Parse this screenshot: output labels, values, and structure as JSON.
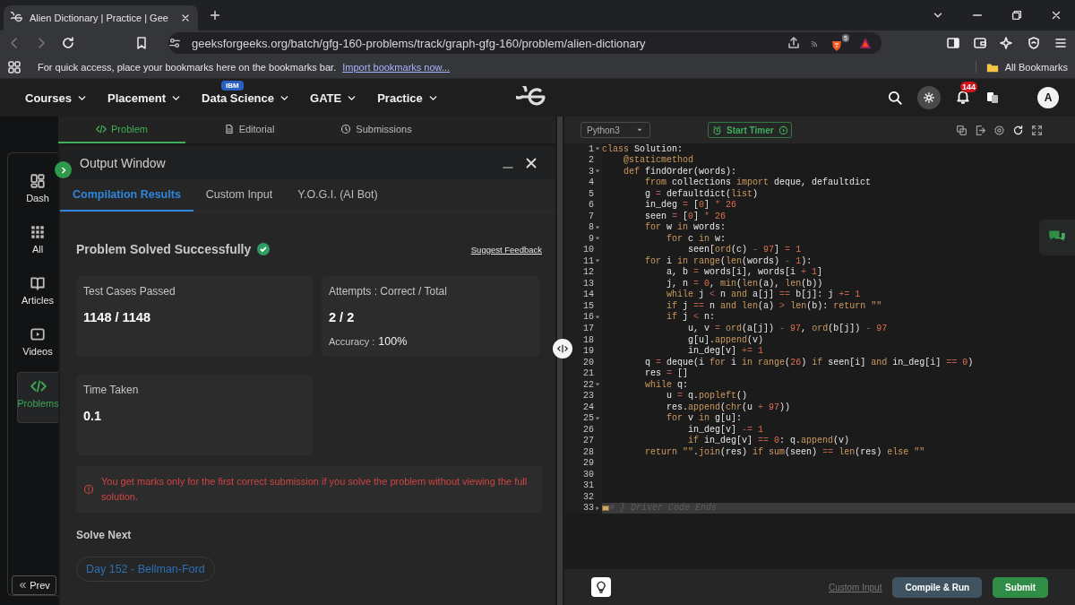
{
  "browser": {
    "tab": {
      "title": "Alien Dictionary | Practice | Gee"
    },
    "url": "geeksforgeeks.org/batch/gfg-160-problems/track/graph-gfg-160/problem/alien-dictionary",
    "extension_badge": "5",
    "bookmarks_bar": {
      "message": "For quick access, place your bookmarks here on the bookmarks bar.",
      "link": "Import bookmarks now...",
      "folder": "All Bookmarks"
    }
  },
  "nav": {
    "menus": [
      {
        "label": "Courses"
      },
      {
        "label": "Placement"
      },
      {
        "label": "Data Science",
        "badge": "IBM"
      },
      {
        "label": "GATE"
      },
      {
        "label": "Practice"
      }
    ],
    "notification_count": "144",
    "avatar": "A"
  },
  "sidebar": {
    "items": [
      {
        "label": "Dash",
        "selected": false
      },
      {
        "label": "All",
        "selected": false
      },
      {
        "label": "Articles",
        "selected": false
      },
      {
        "label": "Videos",
        "selected": false
      },
      {
        "label": "Problems",
        "selected": true
      }
    ],
    "prev_button": "Prev"
  },
  "problem_tabs": [
    {
      "label": "Problem",
      "selected": true
    },
    {
      "label": "Editorial",
      "selected": false
    },
    {
      "label": "Submissions",
      "selected": false
    }
  ],
  "output_window": {
    "title": "Output Window",
    "tabs": [
      {
        "label": "Compilation Results",
        "selected": true
      },
      {
        "label": "Custom Input",
        "selected": false
      },
      {
        "label": "Y.O.G.I. (AI Bot)",
        "selected": false
      }
    ],
    "status": "Problem Solved Successfully",
    "feedback_link": "Suggest Feedback",
    "cards": [
      {
        "label": "Test Cases Passed",
        "value": "1148 / 1148"
      },
      {
        "label": "Attempts : Correct / Total",
        "value": "2 / 2",
        "detail_label": "Accuracy :",
        "detail_value": "100%"
      },
      {
        "label": "Time Taken",
        "value": "0.1"
      }
    ],
    "warning": "You get marks only for the first correct submission if you solve the problem without viewing the full solution.",
    "solve_next": {
      "heading": "Solve Next",
      "link": "Day 152 - Bellman-Ford"
    }
  },
  "editor": {
    "language": "Python3",
    "timer_button": "Start Timer",
    "lines": [
      {
        "number": "1",
        "foldable": true,
        "collapsed": false,
        "active": false,
        "tokens": [
          {
            "kind": "keyword",
            "text": "class"
          },
          {
            "kind": "plain",
            "text": " Solution:"
          }
        ]
      },
      {
        "number": "2",
        "foldable": false,
        "active": false,
        "tokens": [
          {
            "kind": "keyword",
            "text": "    @staticmethod"
          }
        ]
      },
      {
        "number": "3",
        "foldable": true,
        "collapsed": false,
        "active": false,
        "tokens": [
          {
            "kind": "keyword",
            "text": "    def"
          },
          {
            "kind": "plain",
            "text": " findOrder(words):"
          }
        ]
      },
      {
        "number": "4",
        "foldable": false,
        "active": false,
        "tokens": [
          {
            "kind": "keyword",
            "text": "        from"
          },
          {
            "kind": "plain",
            "text": " collections "
          },
          {
            "kind": "keyword",
            "text": "import"
          },
          {
            "kind": "plain",
            "text": " deque, defaultdict"
          }
        ]
      },
      {
        "number": "5",
        "foldable": false,
        "active": false,
        "tokens": [
          {
            "kind": "plain",
            "text": "        g "
          },
          {
            "kind": "operator",
            "text": "="
          },
          {
            "kind": "plain",
            "text": " defaultdict("
          },
          {
            "kind": "keyword",
            "text": "list"
          },
          {
            "kind": "plain",
            "text": ")"
          }
        ]
      },
      {
        "number": "6",
        "foldable": false,
        "active": false,
        "tokens": [
          {
            "kind": "plain",
            "text": "        in_deg "
          },
          {
            "kind": "operator",
            "text": "="
          },
          {
            "kind": "plain",
            "text": " ["
          },
          {
            "kind": "number",
            "text": "0"
          },
          {
            "kind": "plain",
            "text": "] "
          },
          {
            "kind": "operator",
            "text": "*"
          },
          {
            "kind": "number",
            "text": " 26"
          }
        ]
      },
      {
        "number": "7",
        "foldable": false,
        "active": false,
        "tokens": [
          {
            "kind": "plain",
            "text": "        seen "
          },
          {
            "kind": "operator",
            "text": "="
          },
          {
            "kind": "plain",
            "text": " ["
          },
          {
            "kind": "number",
            "text": "0"
          },
          {
            "kind": "plain",
            "text": "] "
          },
          {
            "kind": "operator",
            "text": "*"
          },
          {
            "kind": "number",
            "text": " 26"
          }
        ]
      },
      {
        "number": "8",
        "foldable": true,
        "collapsed": false,
        "active": false,
        "tokens": [
          {
            "kind": "keyword",
            "text": "        for"
          },
          {
            "kind": "plain",
            "text": " w "
          },
          {
            "kind": "keyword",
            "text": "in"
          },
          {
            "kind": "plain",
            "text": " words:"
          }
        ]
      },
      {
        "number": "9",
        "foldable": true,
        "collapsed": false,
        "active": false,
        "tokens": [
          {
            "kind": "keyword",
            "text": "            for"
          },
          {
            "kind": "plain",
            "text": " c "
          },
          {
            "kind": "keyword",
            "text": "in"
          },
          {
            "kind": "plain",
            "text": " w:"
          }
        ]
      },
      {
        "number": "10",
        "foldable": false,
        "active": false,
        "tokens": [
          {
            "kind": "plain",
            "text": "                seen["
          },
          {
            "kind": "keyword",
            "text": "ord"
          },
          {
            "kind": "plain",
            "text": "(c) "
          },
          {
            "kind": "operator",
            "text": "-"
          },
          {
            "kind": "number",
            "text": " 97"
          },
          {
            "kind": "plain",
            "text": "] "
          },
          {
            "kind": "operator",
            "text": "="
          },
          {
            "kind": "number",
            "text": " 1"
          }
        ]
      },
      {
        "number": "11",
        "foldable": true,
        "collapsed": false,
        "active": false,
        "tokens": [
          {
            "kind": "keyword",
            "text": "        for"
          },
          {
            "kind": "plain",
            "text": " i "
          },
          {
            "kind": "keyword",
            "text": "in"
          },
          {
            "kind": "keyword",
            "text": " range"
          },
          {
            "kind": "plain",
            "text": "("
          },
          {
            "kind": "keyword",
            "text": "len"
          },
          {
            "kind": "plain",
            "text": "(words) "
          },
          {
            "kind": "operator",
            "text": "-"
          },
          {
            "kind": "number",
            "text": " 1"
          },
          {
            "kind": "plain",
            "text": "):"
          }
        ]
      },
      {
        "number": "12",
        "foldable": false,
        "active": false,
        "tokens": [
          {
            "kind": "plain",
            "text": "            a, b "
          },
          {
            "kind": "operator",
            "text": "="
          },
          {
            "kind": "plain",
            "text": " words[i], words[i "
          },
          {
            "kind": "operator",
            "text": "+"
          },
          {
            "kind": "number",
            "text": " 1"
          },
          {
            "kind": "plain",
            "text": "]"
          }
        ]
      },
      {
        "number": "13",
        "foldable": false,
        "active": false,
        "tokens": [
          {
            "kind": "plain",
            "text": "            j, n "
          },
          {
            "kind": "operator",
            "text": "="
          },
          {
            "kind": "number",
            "text": " 0"
          },
          {
            "kind": "plain",
            "text": ", "
          },
          {
            "kind": "keyword",
            "text": "min"
          },
          {
            "kind": "plain",
            "text": "("
          },
          {
            "kind": "keyword",
            "text": "len"
          },
          {
            "kind": "plain",
            "text": "(a), "
          },
          {
            "kind": "keyword",
            "text": "len"
          },
          {
            "kind": "plain",
            "text": "(b))"
          }
        ]
      },
      {
        "number": "14",
        "foldable": false,
        "active": false,
        "tokens": [
          {
            "kind": "keyword",
            "text": "            while"
          },
          {
            "kind": "plain",
            "text": " j "
          },
          {
            "kind": "operator",
            "text": "<"
          },
          {
            "kind": "plain",
            "text": " n "
          },
          {
            "kind": "keyword",
            "text": "and"
          },
          {
            "kind": "plain",
            "text": " a[j] "
          },
          {
            "kind": "operator",
            "text": "=="
          },
          {
            "kind": "plain",
            "text": " b[j]: j "
          },
          {
            "kind": "operator",
            "text": "+="
          },
          {
            "kind": "number",
            "text": " 1"
          }
        ]
      },
      {
        "number": "15",
        "foldable": false,
        "active": false,
        "tokens": [
          {
            "kind": "keyword",
            "text": "            if"
          },
          {
            "kind": "plain",
            "text": " j "
          },
          {
            "kind": "operator",
            "text": "=="
          },
          {
            "kind": "plain",
            "text": " n "
          },
          {
            "kind": "keyword",
            "text": "and"
          },
          {
            "kind": "keyword",
            "text": " len"
          },
          {
            "kind": "plain",
            "text": "(a) "
          },
          {
            "kind": "operator",
            "text": ">"
          },
          {
            "kind": "keyword",
            "text": " len"
          },
          {
            "kind": "plain",
            "text": "(b): "
          },
          {
            "kind": "keyword",
            "text": "return"
          },
          {
            "kind": "keyword",
            "text": " \"\""
          }
        ]
      },
      {
        "number": "16",
        "foldable": true,
        "collapsed": false,
        "active": false,
        "tokens": [
          {
            "kind": "keyword",
            "text": "            if"
          },
          {
            "kind": "plain",
            "text": " j "
          },
          {
            "kind": "operator",
            "text": "<"
          },
          {
            "kind": "plain",
            "text": " n:"
          }
        ]
      },
      {
        "number": "17",
        "foldable": false,
        "active": false,
        "tokens": [
          {
            "kind": "plain",
            "text": "                u, v "
          },
          {
            "kind": "operator",
            "text": "="
          },
          {
            "kind": "keyword",
            "text": " ord"
          },
          {
            "kind": "plain",
            "text": "(a[j]) "
          },
          {
            "kind": "operator",
            "text": "-"
          },
          {
            "kind": "number",
            "text": " 97"
          },
          {
            "kind": "plain",
            "text": ", "
          },
          {
            "kind": "keyword",
            "text": "ord"
          },
          {
            "kind": "plain",
            "text": "(b[j]) "
          },
          {
            "kind": "operator",
            "text": "-"
          },
          {
            "kind": "number",
            "text": " 97"
          }
        ]
      },
      {
        "number": "18",
        "foldable": false,
        "active": false,
        "tokens": [
          {
            "kind": "plain",
            "text": "                g[u]."
          },
          {
            "kind": "keyword",
            "text": "append"
          },
          {
            "kind": "plain",
            "text": "(v)"
          }
        ]
      },
      {
        "number": "19",
        "foldable": false,
        "active": false,
        "tokens": [
          {
            "kind": "plain",
            "text": "                in_deg[v] "
          },
          {
            "kind": "operator",
            "text": "+="
          },
          {
            "kind": "number",
            "text": " 1"
          }
        ]
      },
      {
        "number": "20",
        "foldable": false,
        "active": false,
        "tokens": [
          {
            "kind": "plain",
            "text": "        q "
          },
          {
            "kind": "operator",
            "text": "="
          },
          {
            "kind": "plain",
            "text": " deque(i "
          },
          {
            "kind": "keyword",
            "text": "for"
          },
          {
            "kind": "plain",
            "text": " i "
          },
          {
            "kind": "keyword",
            "text": "in"
          },
          {
            "kind": "keyword",
            "text": " range"
          },
          {
            "kind": "plain",
            "text": "("
          },
          {
            "kind": "number",
            "text": "26"
          },
          {
            "kind": "plain",
            "text": ") "
          },
          {
            "kind": "keyword",
            "text": "if"
          },
          {
            "kind": "plain",
            "text": " seen[i] "
          },
          {
            "kind": "keyword",
            "text": "and"
          },
          {
            "kind": "plain",
            "text": " in_deg[i] "
          },
          {
            "kind": "operator",
            "text": "=="
          },
          {
            "kind": "number",
            "text": " 0"
          },
          {
            "kind": "plain",
            "text": ")"
          }
        ]
      },
      {
        "number": "21",
        "foldable": false,
        "active": false,
        "tokens": [
          {
            "kind": "plain",
            "text": "        res "
          },
          {
            "kind": "operator",
            "text": "="
          },
          {
            "kind": "plain",
            "text": " []"
          }
        ]
      },
      {
        "number": "22",
        "foldable": true,
        "collapsed": false,
        "active": false,
        "tokens": [
          {
            "kind": "keyword",
            "text": "        while"
          },
          {
            "kind": "plain",
            "text": " q:"
          }
        ]
      },
      {
        "number": "23",
        "foldable": false,
        "active": false,
        "tokens": [
          {
            "kind": "plain",
            "text": "            u "
          },
          {
            "kind": "operator",
            "text": "="
          },
          {
            "kind": "plain",
            "text": " q."
          },
          {
            "kind": "keyword",
            "text": "popleft"
          },
          {
            "kind": "plain",
            "text": "()"
          }
        ]
      },
      {
        "number": "24",
        "foldable": false,
        "active": false,
        "tokens": [
          {
            "kind": "plain",
            "text": "            res."
          },
          {
            "kind": "keyword",
            "text": "append"
          },
          {
            "kind": "plain",
            "text": "("
          },
          {
            "kind": "keyword",
            "text": "chr"
          },
          {
            "kind": "plain",
            "text": "(u "
          },
          {
            "kind": "operator",
            "text": "+"
          },
          {
            "kind": "number",
            "text": " 97"
          },
          {
            "kind": "plain",
            "text": "))"
          }
        ]
      },
      {
        "number": "25",
        "foldable": true,
        "collapsed": false,
        "active": false,
        "tokens": [
          {
            "kind": "keyword",
            "text": "            for"
          },
          {
            "kind": "plain",
            "text": " v "
          },
          {
            "kind": "keyword",
            "text": "in"
          },
          {
            "kind": "plain",
            "text": " g[u]:"
          }
        ]
      },
      {
        "number": "26",
        "foldable": false,
        "active": false,
        "tokens": [
          {
            "kind": "plain",
            "text": "                in_deg[v] "
          },
          {
            "kind": "operator",
            "text": "-="
          },
          {
            "kind": "number",
            "text": " 1"
          }
        ]
      },
      {
        "number": "27",
        "foldable": false,
        "active": false,
        "tokens": [
          {
            "kind": "keyword",
            "text": "                if"
          },
          {
            "kind": "plain",
            "text": " in_deg[v] "
          },
          {
            "kind": "operator",
            "text": "=="
          },
          {
            "kind": "number",
            "text": " 0"
          },
          {
            "kind": "plain",
            "text": ": q."
          },
          {
            "kind": "keyword",
            "text": "append"
          },
          {
            "kind": "plain",
            "text": "(v)"
          }
        ]
      },
      {
        "number": "28",
        "foldable": false,
        "active": false,
        "tokens": [
          {
            "kind": "keyword",
            "text": "        return"
          },
          {
            "kind": "keyword",
            "text": " \"\""
          },
          {
            "kind": "plain",
            "text": "."
          },
          {
            "kind": "keyword",
            "text": "join"
          },
          {
            "kind": "plain",
            "text": "(res) "
          },
          {
            "kind": "keyword",
            "text": "if"
          },
          {
            "kind": "keyword",
            "text": " sum"
          },
          {
            "kind": "plain",
            "text": "(seen) "
          },
          {
            "kind": "operator",
            "text": "=="
          },
          {
            "kind": "keyword",
            "text": " len"
          },
          {
            "kind": "plain",
            "text": "(res) "
          },
          {
            "kind": "keyword",
            "text": "else"
          },
          {
            "kind": "keyword",
            "text": " \"\""
          }
        ]
      },
      {
        "number": "29",
        "foldable": false,
        "active": false
      },
      {
        "number": "30",
        "foldable": false,
        "active": false
      },
      {
        "number": "31",
        "foldable": false,
        "active": false
      },
      {
        "number": "32",
        "foldable": false,
        "active": false
      },
      {
        "number": "33",
        "foldable": true,
        "collapsed": true,
        "active": true,
        "tokens": [
          {
            "kind": "comment",
            "text": "# } Driver Code Ends"
          }
        ]
      }
    ],
    "custom_input_link": "Custom Input",
    "buttons": [
      {
        "label": "Compile & Run",
        "kind": "secondary"
      },
      {
        "label": "Submit",
        "kind": "primary"
      }
    ]
  }
}
